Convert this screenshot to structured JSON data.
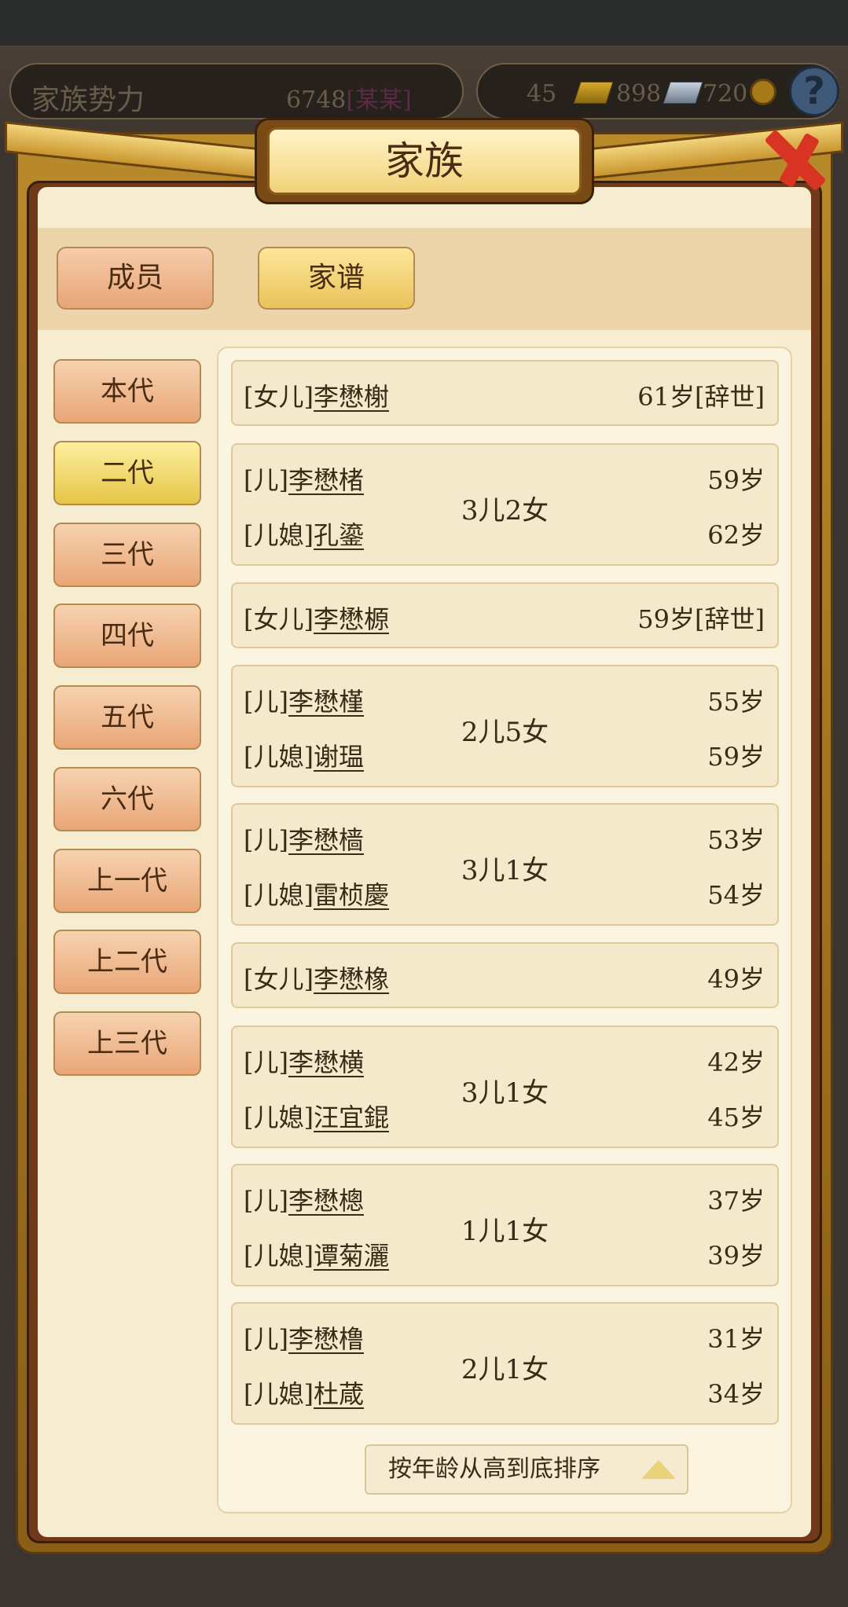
{
  "hud": {
    "title": "家族势力",
    "power": "6748",
    "power_rank": "[某某]",
    "gold": "45",
    "silver": "898",
    "coins": "720",
    "help": "?"
  },
  "dialog": {
    "title": "家族"
  },
  "tabs": {
    "members": "成员",
    "tree": "家谱"
  },
  "generations": [
    {
      "label": "本代",
      "active": false
    },
    {
      "label": "二代",
      "active": true
    },
    {
      "label": "三代",
      "active": false
    },
    {
      "label": "四代",
      "active": false
    },
    {
      "label": "五代",
      "active": false
    },
    {
      "label": "六代",
      "active": false
    },
    {
      "label": "上一代",
      "active": false
    },
    {
      "label": "上二代",
      "active": false
    },
    {
      "label": "上三代",
      "active": false
    }
  ],
  "family": [
    {
      "rel": "[女儿]",
      "name": "李懋榭",
      "age": "61岁[辞世]"
    },
    {
      "rel": "[儿]",
      "name": "李懋楮",
      "age": "59岁",
      "spouse_rel": "[儿媳]",
      "spouse": "孔鎏",
      "spouse_age": "62岁",
      "kids": "3儿2女"
    },
    {
      "rel": "[女儿]",
      "name": "李懋榞",
      "age": "59岁[辞世]"
    },
    {
      "rel": "[儿]",
      "name": "李懋槿",
      "age": "55岁",
      "spouse_rel": "[儿媳]",
      "spouse": "谢瑥",
      "spouse_age": "59岁",
      "kids": "2儿5女"
    },
    {
      "rel": "[儿]",
      "name": "李懋樯",
      "age": "53岁",
      "spouse_rel": "[儿媳]",
      "spouse": "雷桢慶",
      "spouse_age": "54岁",
      "kids": "3儿1女"
    },
    {
      "rel": "[女儿]",
      "name": "李懋橡",
      "age": "49岁"
    },
    {
      "rel": "[儿]",
      "name": "李懋横",
      "age": "42岁",
      "spouse_rel": "[儿媳]",
      "spouse": "汪宜錕",
      "spouse_age": "45岁",
      "kids": "3儿1女"
    },
    {
      "rel": "[儿]",
      "name": "李懋樬",
      "age": "37岁",
      "spouse_rel": "[儿媳]",
      "spouse": "谭菊灑",
      "spouse_age": "39岁",
      "kids": "1儿1女"
    },
    {
      "rel": "[儿]",
      "name": "李懋橹",
      "age": "31岁",
      "spouse_rel": "[儿媳]",
      "spouse": "杜葴",
      "spouse_age": "34岁",
      "kids": "2儿1女"
    }
  ],
  "sort": {
    "label": "按年龄从高到底排序"
  }
}
